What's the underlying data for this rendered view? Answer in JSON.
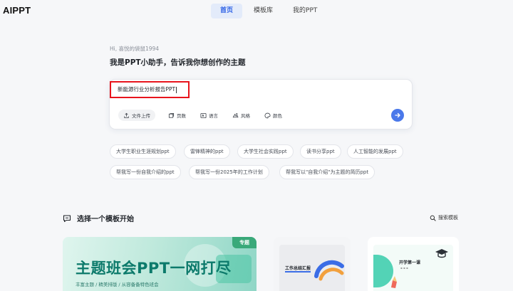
{
  "app": {
    "logo": "AIPPT"
  },
  "nav": {
    "items": [
      "首页",
      "模板库",
      "我的PPT"
    ],
    "active_index": 0
  },
  "greeting": {
    "small": "Hi, 喜悦的袋鼠1994",
    "big": "我是PPT小助手，告诉我你想创作的主题"
  },
  "prompt": {
    "value": "新能源行业分析报告PPT"
  },
  "tools": {
    "upload": "文件上传",
    "pages": "页数",
    "language": "语言",
    "style": "风格",
    "color": "颜色"
  },
  "suggestions": {
    "row1": [
      "大学生职业生涯规划ppt",
      "雷锋精神的ppt",
      "大学生社会实践ppt",
      "读书分享ppt",
      "人工智能的发展ppt"
    ],
    "row2": [
      "帮我写一份自我介绍的ppt",
      "帮我写一份2025年的工作计划",
      "帮我写以\"自我介绍\"为主题的简历ppt"
    ]
  },
  "templates": {
    "section_title": "选择一个模板开始",
    "search_label": "搜索模板",
    "card1": {
      "badge": "专题",
      "title": "主题班会PPT一网打尽",
      "subtitle": "丰富主题 / 精美排版 / 从容备备特色班会"
    },
    "card2": {
      "title": "工作总结汇报"
    },
    "card3": {
      "title": "开学第一课"
    }
  },
  "colors": {
    "accent": "#2d61e6",
    "send_button": "#4a78ea",
    "highlight_border": "#e8141c",
    "card_green": "#3aa97a"
  }
}
